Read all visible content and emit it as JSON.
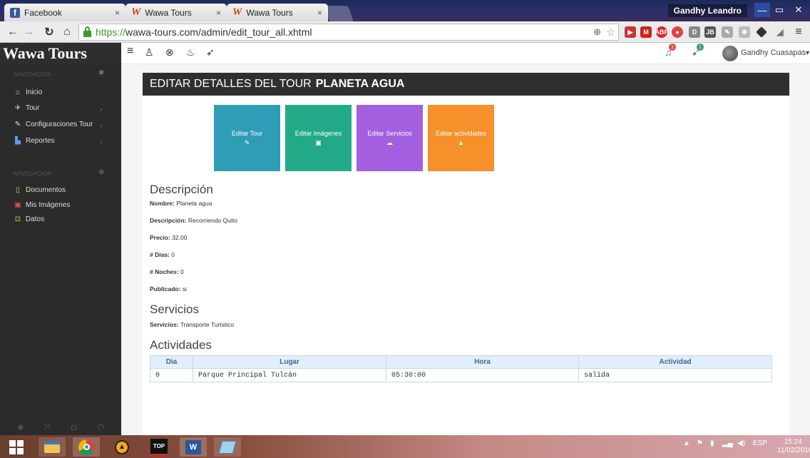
{
  "browser": {
    "tabs": [
      {
        "title": "Facebook",
        "icon": "facebook-icon"
      },
      {
        "title": "Wawa Tours",
        "icon": "wawa-icon"
      },
      {
        "title": "Wawa Tours",
        "icon": "wawa-icon"
      }
    ],
    "close_glyph": "×",
    "profile": "Gandhy Leandro",
    "url_scheme": "https://",
    "url_rest": "wawa-tours.com/admin/edit_tour_all.xhtml"
  },
  "app": {
    "brand": "Wawa Tours",
    "user": "Gandhy Cuasapas",
    "notif_count_1": "1",
    "notif_count_2": "1"
  },
  "sidebar": {
    "head1": "Navegación",
    "items1": [
      {
        "label": "Inicio",
        "icon": "home-icon"
      },
      {
        "label": "Tour",
        "icon": "send-icon"
      },
      {
        "label": "Configuraciones Tour",
        "icon": "edit-icon"
      },
      {
        "label": "Reportes",
        "icon": "bar-chart-icon"
      }
    ],
    "head2": "Navegación",
    "items2": [
      {
        "label": "Documentos",
        "icon": "file-icon",
        "color": "#f0c24a"
      },
      {
        "label": "Mis Imágenes",
        "icon": "image-icon",
        "color": "#e2574c"
      },
      {
        "label": "Datos",
        "icon": "lock-icon",
        "color": "#f0c24a"
      }
    ]
  },
  "main": {
    "title_prefix": "EDITAR DETALLES DEL TOUR",
    "title_name": "PLANETA AGUA",
    "tiles": [
      {
        "label": "Editar Tour",
        "color": "#2e9db5",
        "icon": "pencil-icon",
        "glyph": "✎"
      },
      {
        "label": "Editar Imágenes",
        "color": "#22aa88",
        "icon": "image-icon",
        "glyph": "▣"
      },
      {
        "label": "Editar Servicios",
        "color": "#a45ee0",
        "icon": "cloud-icon",
        "glyph": "☁"
      },
      {
        "label": "Editar actividades",
        "color": "#f5902a",
        "icon": "bell-icon",
        "glyph": "▲"
      }
    ],
    "descripcion_heading": "Descripción",
    "fields": [
      {
        "label": "Nombre:",
        "value": "Planeta agua"
      },
      {
        "label": "Descripción:",
        "value": "Recorriendo Quito"
      },
      {
        "label": "Precio:",
        "value": "32.00"
      },
      {
        "label": "# Días:",
        "value": "0"
      },
      {
        "label": "# Noches:",
        "value": "0"
      },
      {
        "label": "Publicado:",
        "value": "si"
      }
    ],
    "servicios_heading": "Servicios",
    "servicios_label": "Servicios:",
    "servicios_value": "Transporte Turístico",
    "actividades_heading": "Actividades",
    "table": {
      "headers": [
        "Dia",
        "Lugar",
        "Hora",
        "Actividad"
      ],
      "rows": [
        [
          "0",
          "Parque Principal Tulcán",
          "05:30:00",
          "salida"
        ]
      ]
    }
  },
  "taskbar": {
    "lang": "ESP",
    "time": "15:24",
    "date": "11/02/2016"
  }
}
